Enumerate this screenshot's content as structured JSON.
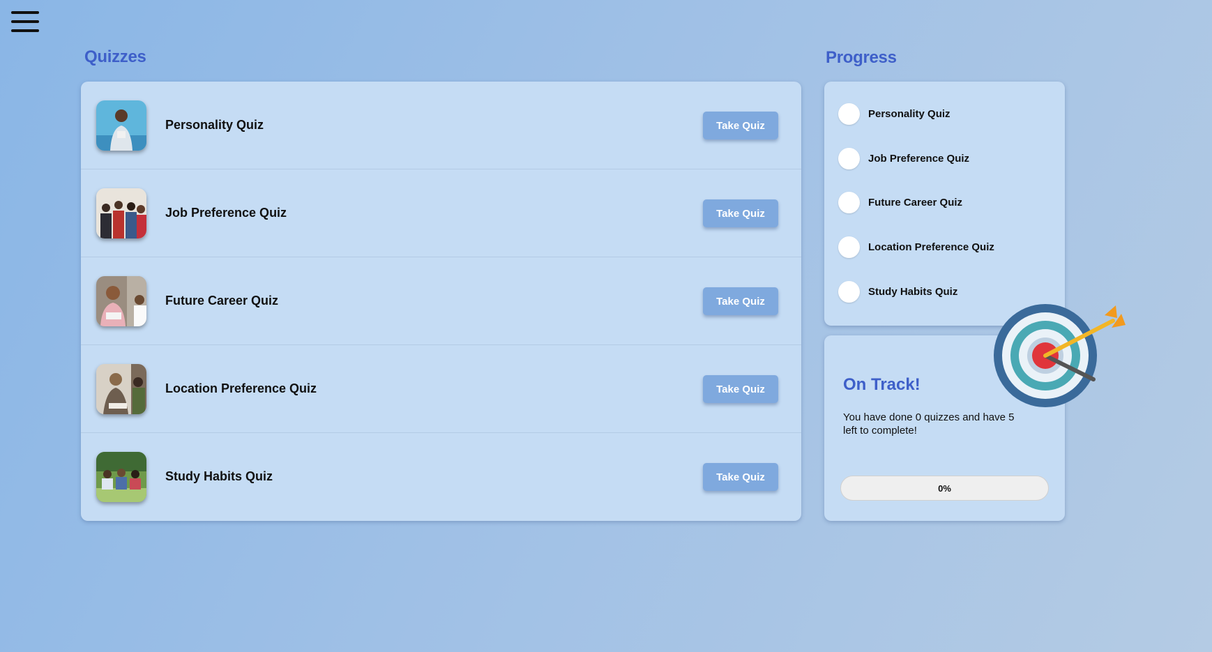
{
  "menu": {
    "icon": "hamburger-menu-icon"
  },
  "quizzes": {
    "title": "Quizzes",
    "items": [
      {
        "name": "Personality Quiz",
        "button": "Take Quiz",
        "thumb": "person-photo",
        "thumb_colors": [
          "#5fb6dc",
          "#3d8fbf"
        ]
      },
      {
        "name": "Job Preference Quiz",
        "button": "Take Quiz",
        "thumb": "group-photo",
        "thumb_colors": [
          "#e9e4dc",
          "#b9332e"
        ]
      },
      {
        "name": "Future Career Quiz",
        "button": "Take Quiz",
        "thumb": "students-photo",
        "thumb_colors": [
          "#9a8d80",
          "#e9b0b8"
        ]
      },
      {
        "name": "Location Preference Quiz",
        "button": "Take Quiz",
        "thumb": "students-photo",
        "thumb_colors": [
          "#d8d1c6",
          "#6e5e4f"
        ]
      },
      {
        "name": "Study Habits Quiz",
        "button": "Take Quiz",
        "thumb": "outdoor-photo",
        "thumb_colors": [
          "#6f9a4a",
          "#a7c873"
        ]
      }
    ]
  },
  "progress": {
    "title": "Progress",
    "items": [
      {
        "label": "Personality Quiz",
        "done": false
      },
      {
        "label": "Job Preference Quiz",
        "done": false
      },
      {
        "label": "Future Career Quiz",
        "done": false
      },
      {
        "label": "Location Preference Quiz",
        "done": false
      },
      {
        "label": "Study Habits Quiz",
        "done": false
      }
    ]
  },
  "status": {
    "title": "On Track!",
    "message": "You have done 0 quizzes and have 5 left to complete!",
    "progress_percent": 0,
    "progress_label": "0%",
    "icon": "target-arrow-icon"
  },
  "colors": {
    "accent": "#3e5fc9",
    "button": "#7fa9de",
    "panel": "#c5dcf4"
  }
}
